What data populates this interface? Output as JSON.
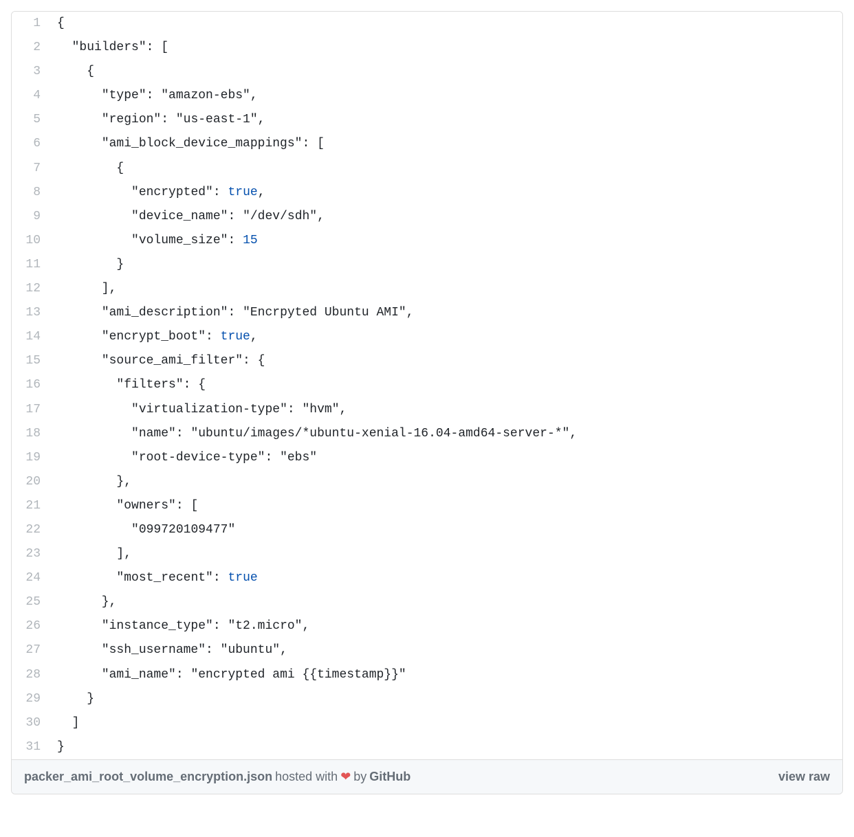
{
  "code": {
    "lines": [
      {
        "num": "1",
        "html": "{"
      },
      {
        "num": "2",
        "html": "  <span class=\"pl-s\">\"builders\"</span>: ["
      },
      {
        "num": "3",
        "html": "    {"
      },
      {
        "num": "4",
        "html": "      <span class=\"pl-s\">\"type\"</span>: <span class=\"pl-s\">\"amazon-ebs\"</span>,"
      },
      {
        "num": "5",
        "html": "      <span class=\"pl-s\">\"region\"</span>: <span class=\"pl-s\">\"us-east-1\"</span>,"
      },
      {
        "num": "6",
        "html": "      <span class=\"pl-s\">\"ami_block_device_mappings\"</span>: ["
      },
      {
        "num": "7",
        "html": "        {"
      },
      {
        "num": "8",
        "html": "          <span class=\"pl-s\">\"encrypted\"</span>: <span class=\"pl-c1\">true</span>,"
      },
      {
        "num": "9",
        "html": "          <span class=\"pl-s\">\"device_name\"</span>: <span class=\"pl-s\">\"/dev/sdh\"</span>,"
      },
      {
        "num": "10",
        "html": "          <span class=\"pl-s\">\"volume_size\"</span>: <span class=\"pl-c1\">15</span>"
      },
      {
        "num": "11",
        "html": "        }"
      },
      {
        "num": "12",
        "html": "      ],"
      },
      {
        "num": "13",
        "html": "      <span class=\"pl-s\">\"ami_description\"</span>: <span class=\"pl-s\">\"Encrpyted Ubuntu AMI\"</span>,"
      },
      {
        "num": "14",
        "html": "      <span class=\"pl-s\">\"encrypt_boot\"</span>: <span class=\"pl-c1\">true</span>,"
      },
      {
        "num": "15",
        "html": "      <span class=\"pl-s\">\"source_ami_filter\"</span>: {"
      },
      {
        "num": "16",
        "html": "        <span class=\"pl-s\">\"filters\"</span>: {"
      },
      {
        "num": "17",
        "html": "          <span class=\"pl-s\">\"virtualization-type\"</span>: <span class=\"pl-s\">\"hvm\"</span>,"
      },
      {
        "num": "18",
        "html": "          <span class=\"pl-s\">\"name\"</span>: <span class=\"pl-s\">\"ubuntu/images/*ubuntu-xenial-16.04-amd64-server-*\"</span>,"
      },
      {
        "num": "19",
        "html": "          <span class=\"pl-s\">\"root-device-type\"</span>: <span class=\"pl-s\">\"ebs\"</span>"
      },
      {
        "num": "20",
        "html": "        },"
      },
      {
        "num": "21",
        "html": "        <span class=\"pl-s\">\"owners\"</span>: ["
      },
      {
        "num": "22",
        "html": "          <span class=\"pl-s\">\"099720109477\"</span>"
      },
      {
        "num": "23",
        "html": "        ],"
      },
      {
        "num": "24",
        "html": "        <span class=\"pl-s\">\"most_recent\"</span>: <span class=\"pl-c1\">true</span>"
      },
      {
        "num": "25",
        "html": "      },"
      },
      {
        "num": "26",
        "html": "      <span class=\"pl-s\">\"instance_type\"</span>: <span class=\"pl-s\">\"t2.micro\"</span>,"
      },
      {
        "num": "27",
        "html": "      <span class=\"pl-s\">\"ssh_username\"</span>: <span class=\"pl-s\">\"ubuntu\"</span>,"
      },
      {
        "num": "28",
        "html": "      <span class=\"pl-s\">\"ami_name\"</span>: <span class=\"pl-s\">\"encrypted ami {{timestamp}}\"</span>"
      },
      {
        "num": "29",
        "html": "    }"
      },
      {
        "num": "30",
        "html": "  ]"
      },
      {
        "num": "31",
        "html": "}"
      }
    ]
  },
  "footer": {
    "filename": "packer_ami_root_volume_encryption.json",
    "hosted_with": " hosted with ",
    "heart": "❤",
    "by": " by ",
    "github": "GitHub",
    "view_raw": "view raw"
  }
}
